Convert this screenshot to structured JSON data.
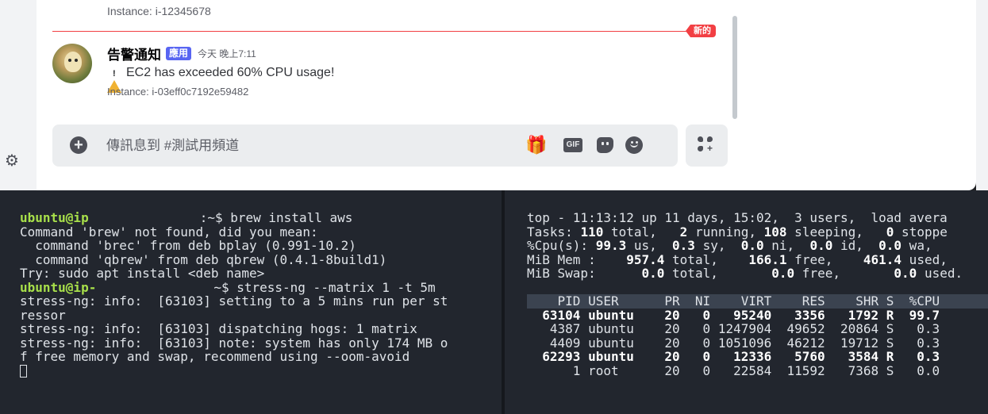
{
  "chat": {
    "previous_instance": "Instance: i-12345678",
    "new_badge": "新的",
    "message": {
      "username": "告警通知",
      "app_tag": "應用",
      "timestamp": "今天 晚上7:11",
      "text": "EC2 has exceeded 60% CPU usage!",
      "instance": "Instance: i-03eff0c7192e59482"
    },
    "composer": {
      "placeholder": "傳訊息到 #測試用頻道",
      "gif_label": "GIF"
    },
    "colors": {
      "accent": "#5865f2",
      "new": "#f23f43",
      "warning": "#f0b232"
    }
  },
  "terminal_left": {
    "lines": [
      {
        "user": "ubuntu@ip",
        "host_tail": ":~$",
        "cmd": " brew install aws"
      },
      {
        "text": "Command 'brew' not found, did you mean:"
      },
      {
        "text": "  command 'brec' from deb bplay (0.991-10.2)"
      },
      {
        "text": "  command 'qbrew' from deb qbrew (0.4.1-8build1)"
      },
      {
        "text": "Try: sudo apt install <deb name>"
      },
      {
        "user": "ubuntu@ip-",
        "host_tail": "~$",
        "cmd": " stress-ng --matrix 1 -t 5m"
      },
      {
        "text": "stress-ng: info:  [63103] setting to a 5 mins run per st"
      },
      {
        "text": "ressor"
      },
      {
        "text": "stress-ng: info:  [63103] dispatching hogs: 1 matrix"
      },
      {
        "text": "stress-ng: info:  [63103] note: system has only 174 MB o"
      },
      {
        "text": "f free memory and swap, recommend using --oom-avoid"
      }
    ]
  },
  "terminal_right": {
    "summary": {
      "line1": "top - 11:13:12 up 11 days, 15:02,  3 users,  load avera",
      "tasks_prefix": "Tasks: ",
      "tasks_total": "110",
      "tasks_mid1": " total,   ",
      "tasks_running": "2",
      "tasks_mid2": " running, ",
      "tasks_sleeping": "108",
      "tasks_mid3": " sleeping,   ",
      "tasks_stopped": "0",
      "tasks_suffix": " stoppe",
      "cpu_prefix": "%Cpu(s): ",
      "cpu_us": "99.3",
      "cpu_mid1": " us,  ",
      "cpu_sy": "0.3",
      "cpu_mid2": " sy,  ",
      "cpu_ni": "0.0",
      "cpu_mid3": " ni,  ",
      "cpu_id": "0.0",
      "cpu_mid4": " id,  ",
      "cpu_wa": "0.0",
      "cpu_suffix": " wa,",
      "mem_prefix": "MiB Mem :    ",
      "mem_total": "957.4",
      "mem_mid1": " total,    ",
      "mem_free": "166.1",
      "mem_mid2": " free,    ",
      "mem_used": "461.4",
      "mem_suffix": " used,",
      "swap_prefix": "MiB Swap:      ",
      "swap_total": "0.0",
      "swap_mid1": " total,       ",
      "swap_free": "0.0",
      "swap_mid2": " free,       ",
      "swap_used": "0.0",
      "swap_suffix": " used."
    },
    "table_header": "    PID USER      PR  NI    VIRT    RES    SHR S  %CPU",
    "rows": [
      {
        "text": "  63104 ubuntu    20   0   95240   3356   1792 R  99.7",
        "bold": true
      },
      {
        "text": "   4387 ubuntu    20   0 1247904  49652  20864 S   0.3",
        "bold": false
      },
      {
        "text": "   4409 ubuntu    20   0 1051096  46212  19712 S   0.3",
        "bold": false
      },
      {
        "text": "  62293 ubuntu    20   0   12336   5760   3584 R   0.3",
        "bold": true
      },
      {
        "text": "      1 root      20   0   22584  11592   7368 S   0.0",
        "bold": false
      }
    ]
  }
}
